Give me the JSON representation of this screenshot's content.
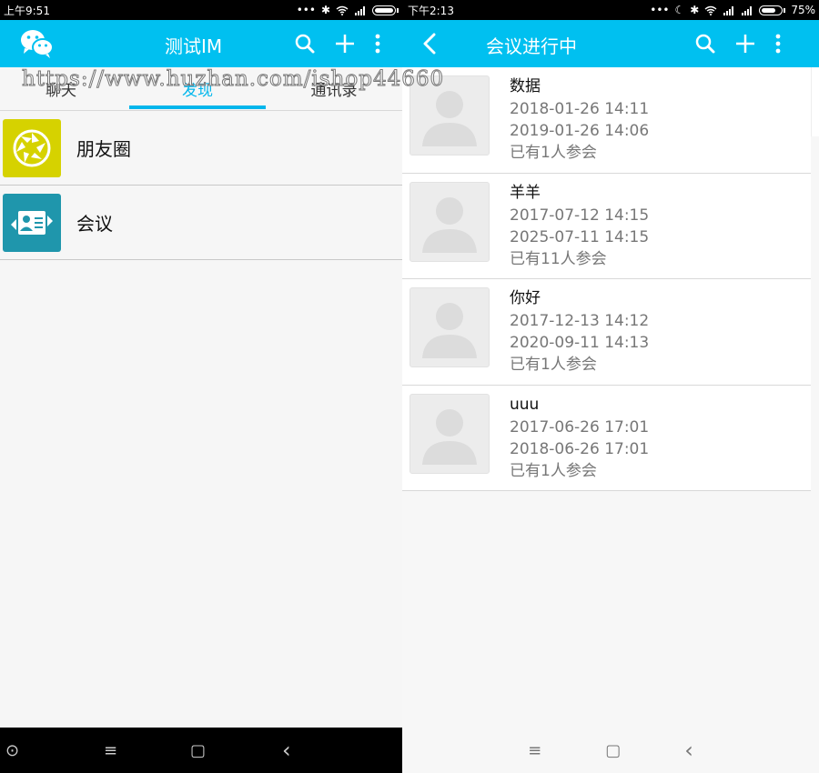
{
  "left": {
    "status": {
      "time": "上午9:51",
      "dots": "•••"
    },
    "appbar": {
      "title": "测试IM",
      "app_icon": "wechat-icon",
      "search_icon": "search-icon",
      "add_icon": "plus-icon",
      "more_icon": "more-vertical-icon"
    },
    "tabs": [
      {
        "label": "聊天"
      },
      {
        "label": "发现"
      },
      {
        "label": "通讯录"
      }
    ],
    "watermark": "https://www.huzhan.com/ishop44660",
    "discover_items": [
      {
        "label": "朋友圈",
        "icon": "camera-aperture-icon",
        "color": "#d6d200"
      },
      {
        "label": "会议",
        "icon": "meeting-card-icon",
        "color": "#1f96ac"
      }
    ],
    "nav": {
      "home": "⊙",
      "menu": "≡",
      "square": "▢",
      "back": "‹"
    }
  },
  "right": {
    "status": {
      "time": "下午2:13",
      "dots": "•••",
      "battery": "75%"
    },
    "appbar": {
      "title": "会议进行中",
      "back_icon": "back-arrow-icon",
      "search_icon": "search-icon",
      "add_icon": "plus-icon",
      "more_icon": "more-vertical-icon"
    },
    "meetings": [
      {
        "name": "数据",
        "start": "2018-01-26 14:11",
        "end": "2019-01-26 14:06",
        "count": "已有1人参会"
      },
      {
        "name": "羊羊",
        "start": "2017-07-12 14:15",
        "end": "2025-07-11 14:15",
        "count": "已有11人参会"
      },
      {
        "name": "你好",
        "start": "2017-12-13 14:12",
        "end": "2020-09-11 14:13",
        "count": "已有1人参会"
      },
      {
        "name": "uuu",
        "start": "2017-06-26 17:01",
        "end": "2018-06-26 17:01",
        "count": "已有1人参会"
      }
    ],
    "nav": {
      "menu": "≡",
      "square": "▢",
      "back": "‹"
    }
  },
  "colors": {
    "accent": "#00c0f0",
    "tab_active": "#00b6ec"
  }
}
